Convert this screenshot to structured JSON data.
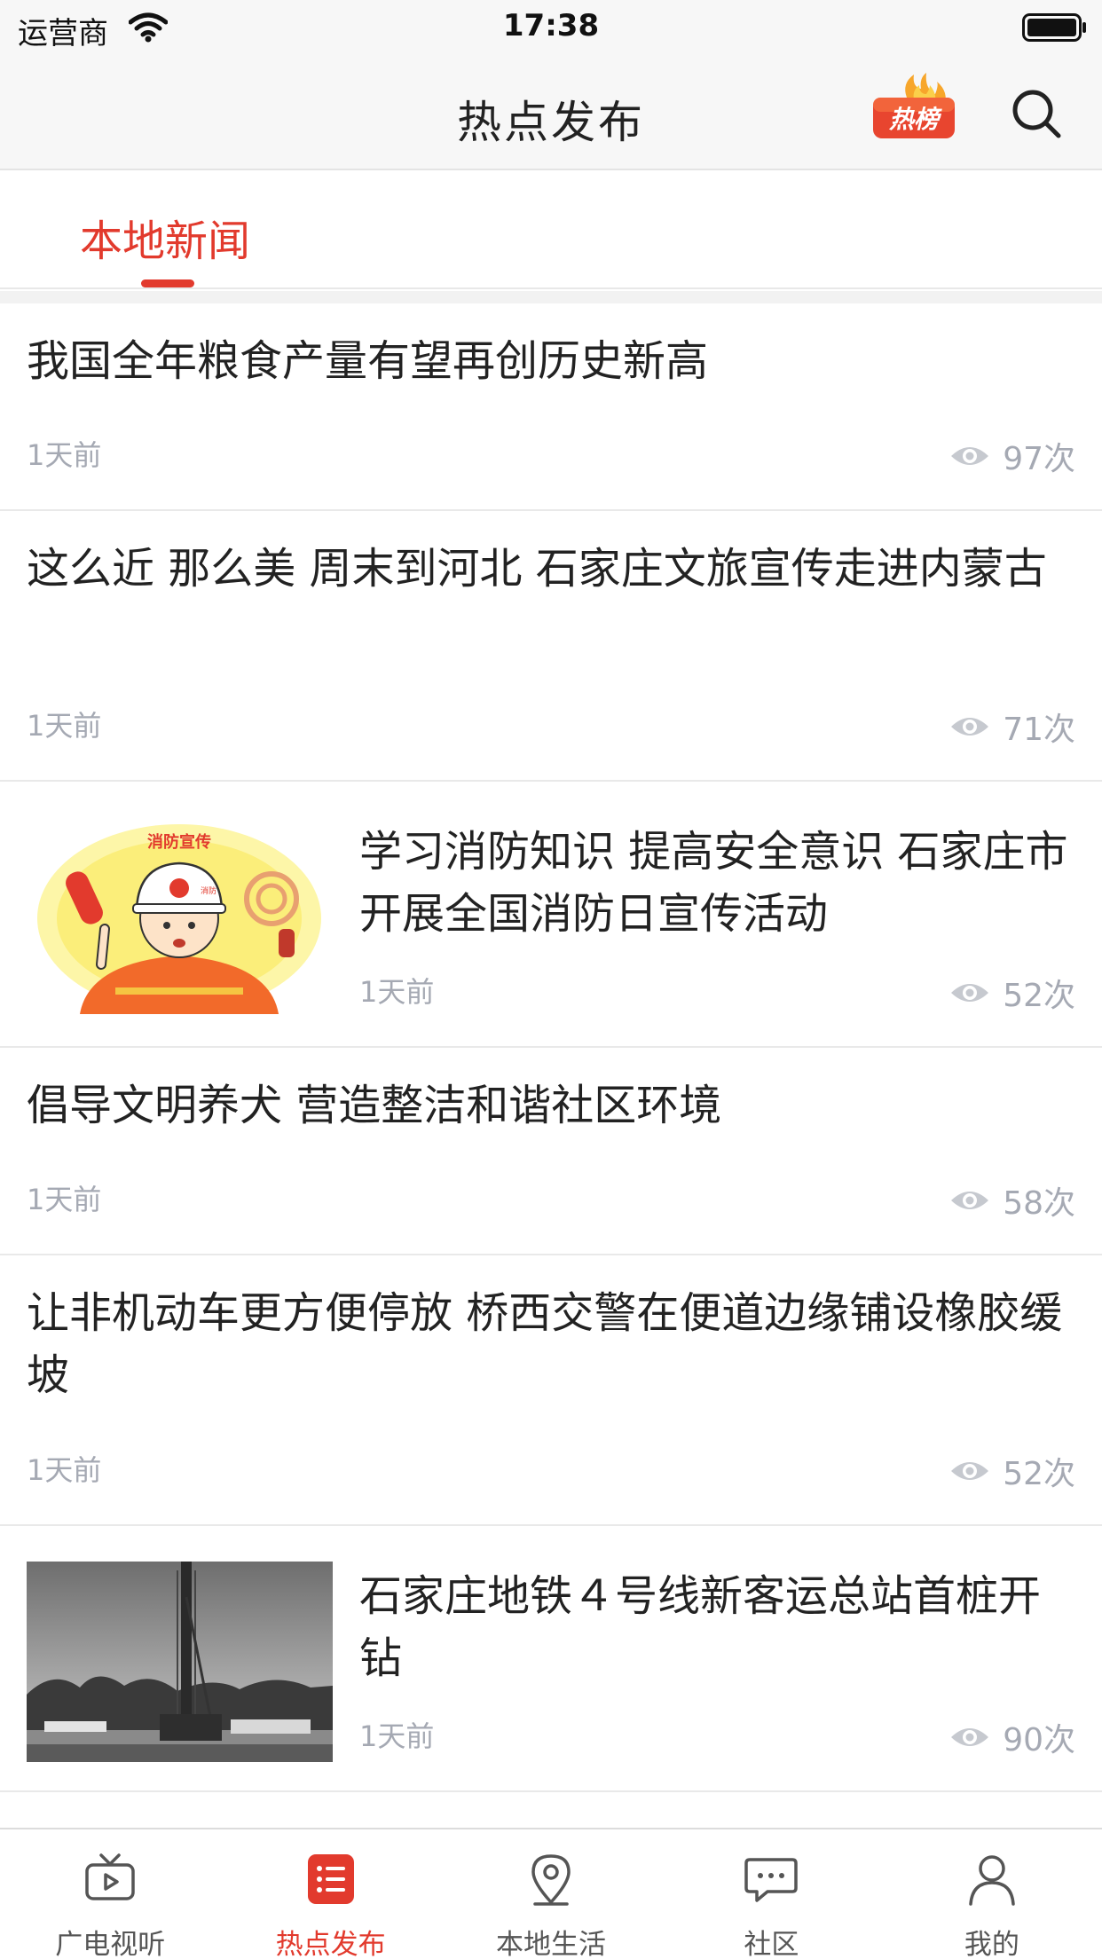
{
  "status_bar": {
    "carrier": "运营商",
    "time": "17:38"
  },
  "header": {
    "title": "热点发布",
    "hot_badge_label": "热榜"
  },
  "tabs": [
    {
      "label": "本地新闻",
      "active": true
    }
  ],
  "news": [
    {
      "title": "我国全年粮食产量有望再创历史新高",
      "time": "1天前",
      "views": "97次"
    },
    {
      "title": "这么近 那么美 周末到河北 石家庄文旅宣传走进内蒙古",
      "time": "1天前",
      "views": "71次"
    },
    {
      "title": "学习消防知识 提高安全意识 石家庄市开展全国消防日宣传活动",
      "time": "1天前",
      "views": "52次",
      "thumb_caption": "消防宣传",
      "helmet_text": "消防"
    },
    {
      "title": "倡导文明养犬 营造整洁和谐社区环境",
      "time": "1天前",
      "views": "58次"
    },
    {
      "title": "让非机动车更方便停放 桥西交警在便道边缘铺设橡胶缓坡",
      "time": "1天前",
      "views": "52次"
    },
    {
      "title": "石家庄地铁４号线新客运总站首桩开钻",
      "time": "1天前",
      "views": "90次"
    }
  ],
  "bottom_nav": [
    {
      "label": "广电视听",
      "icon": "tv-icon",
      "active": false
    },
    {
      "label": "热点发布",
      "icon": "list-icon",
      "active": true
    },
    {
      "label": "本地生活",
      "icon": "location-pin-icon",
      "active": false
    },
    {
      "label": "社区",
      "icon": "chat-bubble-icon",
      "active": false
    },
    {
      "label": "我的",
      "icon": "person-icon",
      "active": false
    }
  ],
  "colors": {
    "accent": "#e23a2d",
    "meta_text": "#a5a9b3",
    "nav_bg": "#f7f7f7"
  }
}
